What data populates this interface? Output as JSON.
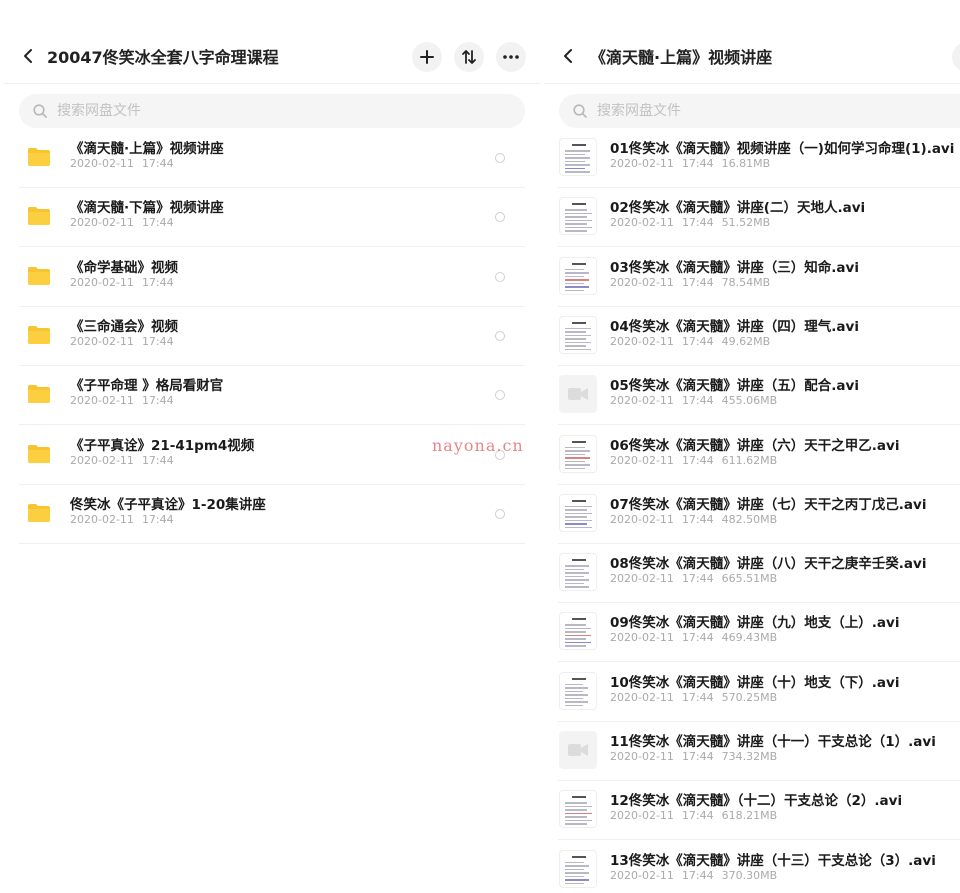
{
  "left": {
    "title": "20047佟笑冰全套八字命理课程",
    "search_placeholder": "搜索网盘文件",
    "items": [
      {
        "name": "《滴天髓·上篇》视频讲座",
        "date": "2020-02-11",
        "time": "17:44"
      },
      {
        "name": "《滴天髓·下篇》视频讲座",
        "date": "2020-02-11",
        "time": "17:44"
      },
      {
        "name": "《命学基础》视频",
        "date": "2020-02-11",
        "time": "17:44"
      },
      {
        "name": "《三命通会》视频",
        "date": "2020-02-11",
        "time": "17:44"
      },
      {
        "name": "《子平命理 》格局看财官",
        "date": "2020-02-11",
        "time": "17:44"
      },
      {
        "name": "《子平真诠》21-41pm4视频",
        "date": "2020-02-11",
        "time": "17:44"
      },
      {
        "name": "佟笑冰《子平真诠》1-20集讲座",
        "date": "2020-02-11",
        "time": "17:44"
      }
    ]
  },
  "right": {
    "title": "《滴天髓·上篇》视频讲座",
    "search_placeholder": "搜索网盘文件",
    "items": [
      {
        "name": "01佟笑冰《滴天髓》视频讲座（一)如何学习命理(1).avi",
        "date": "2020-02-11",
        "time": "17:44",
        "size": "16.81MB",
        "thumb": "doc"
      },
      {
        "name": "02佟笑冰《滴天髓》讲座(二）天地人.avi",
        "date": "2020-02-11",
        "time": "17:44",
        "size": "51.52MB",
        "thumb": "doc"
      },
      {
        "name": "03佟笑冰《滴天髓》讲座（三）知命.avi",
        "date": "2020-02-11",
        "time": "17:44",
        "size": "78.54MB",
        "thumb": "doc"
      },
      {
        "name": "04佟笑冰《滴天髓》讲座（四）理气.avi",
        "date": "2020-02-11",
        "time": "17:44",
        "size": "49.62MB",
        "thumb": "doc"
      },
      {
        "name": "05佟笑冰《滴天髓》讲座（五）配合.avi",
        "date": "2020-02-11",
        "time": "17:44",
        "size": "455.06MB",
        "thumb": "video"
      },
      {
        "name": "06佟笑冰《滴天髓》讲座（六）天干之甲乙.avi",
        "date": "2020-02-11",
        "time": "17:44",
        "size": "611.62MB",
        "thumb": "doc"
      },
      {
        "name": "07佟笑冰《滴天髓》讲座（七）天干之丙丁戊己.avi",
        "date": "2020-02-11",
        "time": "17:44",
        "size": "482.50MB",
        "thumb": "doc"
      },
      {
        "name": "08佟笑冰《滴天髓》讲座（八）天干之庚辛壬癸.avi",
        "date": "2020-02-11",
        "time": "17:44",
        "size": "665.51MB",
        "thumb": "doc"
      },
      {
        "name": "09佟笑冰《滴天髓》讲座（九）地支（上）.avi",
        "date": "2020-02-11",
        "time": "17:44",
        "size": "469.43MB",
        "thumb": "doc"
      },
      {
        "name": "10佟笑冰《滴天髓》讲座（十）地支（下）.avi",
        "date": "2020-02-11",
        "time": "17:44",
        "size": "570.25MB",
        "thumb": "doc"
      },
      {
        "name": "11佟笑冰《滴天髓》讲座（十一）干支总论（1）.avi",
        "date": "2020-02-11",
        "time": "17:44",
        "size": "734.32MB",
        "thumb": "video"
      },
      {
        "name": "12佟笑冰《滴天髓》（十二）干支总论（2）.avi",
        "date": "2020-02-11",
        "time": "17:44",
        "size": "618.21MB",
        "thumb": "doc"
      },
      {
        "name": "13佟笑冰《滴天髓》讲座（十三）干支总论（3）.avi",
        "date": "2020-02-11",
        "time": "17:44",
        "size": "370.30MB",
        "thumb": "doc"
      }
    ]
  },
  "watermark": "nayona.cn",
  "colors": {
    "folder": "#f7c531",
    "title": "#1a1a1a",
    "meta": "#aaaaaa",
    "watermark": "#e06a6a"
  }
}
